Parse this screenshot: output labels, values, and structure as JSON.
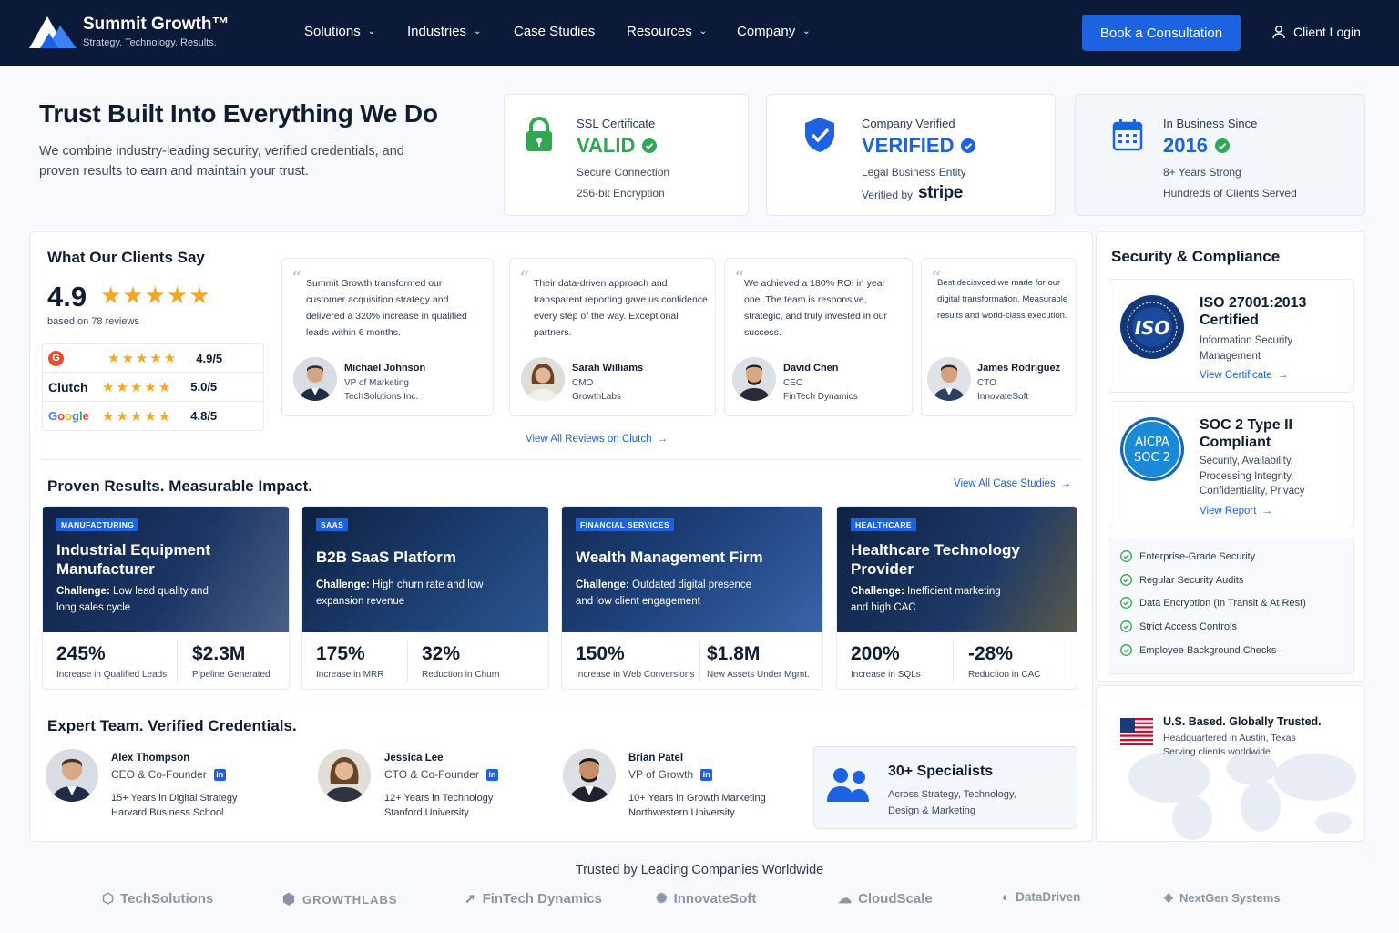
{
  "header": {
    "brand": "Summit Growth™",
    "tagline": "Strategy. Technology. Results.",
    "nav": [
      {
        "label": "Solutions",
        "dropdown": true
      },
      {
        "label": "Industries",
        "dropdown": true
      },
      {
        "label": "Case Studies",
        "dropdown": false
      },
      {
        "label": "Resources",
        "dropdown": true
      },
      {
        "label": "Company",
        "dropdown": true
      }
    ],
    "cta": "Book a Consultation",
    "login": "Client Login"
  },
  "hero": {
    "title": "Trust Built Into Everything We Do",
    "subtitle": "We combine industry-leading security, verified credentials, and proven results to earn and maintain your trust."
  },
  "trust_cards": [
    {
      "label": "SSL Certificate",
      "value": "VALID",
      "line1": "Secure Connection",
      "line2": "256-bit Encryption",
      "icon": "lock-icon",
      "color": "#2fa84f"
    },
    {
      "label": "Company Verified",
      "value": "VERIFIED",
      "line1": "Legal Business Entity",
      "line2": "Verified by",
      "line2_brand": "stripe",
      "icon": "shield-check-icon",
      "color": "#1d62e0"
    },
    {
      "label": "In Business Since",
      "value": "2016",
      "line1": "8+ Years Strong",
      "line2": "Hundreds of Clients Served",
      "icon": "calendar-icon",
      "color": "#1d62e0"
    }
  ],
  "reviews": {
    "title": "What Our Clients Say",
    "score": "4.9",
    "based_on": "based on 78 reviews",
    "platforms": [
      {
        "name": "G2",
        "score": "4.9/5"
      },
      {
        "name": "Clutch",
        "score": "5.0/5"
      },
      {
        "name": "Google",
        "score": "4.8/5"
      }
    ],
    "items": [
      {
        "text": "Summit Growth transformed our customer acquisition strategy and delivered a 320% increase in qualified leads within 6 months.",
        "name": "Michael Johnson",
        "role": "VP of Marketing",
        "company": "TechSolutions Inc."
      },
      {
        "text": "Their data-driven approach and transparent reporting gave us confidence every step of the way. Exceptional partners.",
        "name": "Sarah Williams",
        "role": "CMO",
        "company": "GrowthLabs"
      },
      {
        "text": "We achieved a 180% ROI in year one. The team is responsive, strategic, and truly invested in our success.",
        "name": "David Chen",
        "role": "CEO",
        "company": "FinTech Dynamics"
      },
      {
        "text": "Best decisvced we made for our digital transformation. Measurable results and world-class execution.",
        "name": "James Rodriguez",
        "role": "CTO",
        "company": "InnovateSoft"
      }
    ],
    "view_all": "View All Reviews on Clutch"
  },
  "results": {
    "title": "Proven Results. Measurable Impact.",
    "view_all": "View All Case Studies",
    "cases": [
      {
        "tag": "MANUFACTURING",
        "title": "Industrial Equipment Manufacturer",
        "challenge_label": "Challenge:",
        "challenge": "Low lead quality and long sales cycle",
        "m1v": "245%",
        "m1l": "Increase in Qualified Leads",
        "m2v": "$2.3M",
        "m2l": "Pipeline Generated"
      },
      {
        "tag": "SAAS",
        "title": "B2B SaaS Platform",
        "challenge_label": "Challenge:",
        "challenge": "High churn rate and low expansion revenue",
        "m1v": "175%",
        "m1l": "Increase in MRR",
        "m2v": "32%",
        "m2l": "Reduction in Churn"
      },
      {
        "tag": "FINANCIAL SERVICES",
        "title": "Wealth Management Firm",
        "challenge_label": "Challenge:",
        "challenge": "Outdated digital presence and low client engagement",
        "m1v": "150%",
        "m1l": "Increase in Web Conversions",
        "m2v": "$1.8M",
        "m2l": "New Assets Under Mgmt."
      },
      {
        "tag": "HEALTHCARE",
        "title": "Healthcare Technology Provider",
        "challenge_label": "Challenge:",
        "challenge": "Inefficient marketing and high CAC",
        "m1v": "200%",
        "m1l": "Increase in SQLs",
        "m2v": "-28%",
        "m2l": "Reduction in CAC"
      }
    ]
  },
  "team": {
    "title": "Expert Team. Verified Credentials.",
    "members": [
      {
        "name": "Alex Thompson",
        "role": "CEO & Co-Founder",
        "line1": "15+ Years in Digital Strategy",
        "line2": "Harvard Business School"
      },
      {
        "name": "Jessica Lee",
        "role": "CTO & Co-Founder",
        "line1": "12+ Years in Technology",
        "line2": "Stanford University"
      },
      {
        "name": "Brian Patel",
        "role": "VP of Growth",
        "line1": "10+ Years in Growth Marketing",
        "line2": "Northwestern University"
      }
    ],
    "specialists_title": "30+ Specialists",
    "specialists_text": "Across Strategy, Technology, Design & Marketing"
  },
  "security": {
    "title": "Security & Compliance",
    "iso": {
      "badge": "ISO",
      "title": "ISO 27001:2013 Certified",
      "desc": "Information Security Management",
      "link": "View Certificate"
    },
    "soc": {
      "badge_top": "AICPA",
      "badge_bottom": "SOC 2",
      "title": "SOC 2 Type II Compliant",
      "desc": "Security, Availability, Processing Integrity, Confidentiality, Privacy",
      "link": "View Report"
    },
    "checks": [
      "Enterprise-Grade Security",
      "Regular Security Audits",
      "Data Encryption (In Transit & At Rest)",
      "Strict Access Controls",
      "Employee Background Checks"
    ],
    "us_title": "U.S. Based. Globally Trusted.",
    "us_line1": "Headquartered in Austin, Texas",
    "us_line2": "Serving clients worldwide"
  },
  "trusted": {
    "title": "Trusted by Leading Companies Worldwide",
    "logos": [
      "TechSolutions",
      "GROWTHLABS",
      "FinTech Dynamics",
      "InnovateSoft",
      "CloudScale",
      "DataDriven",
      "NextGen Systems"
    ]
  },
  "colors": {
    "navy": "#0c1a3a",
    "accent": "#1d62e0",
    "success": "#2fa84f",
    "star": "#f5a623"
  }
}
